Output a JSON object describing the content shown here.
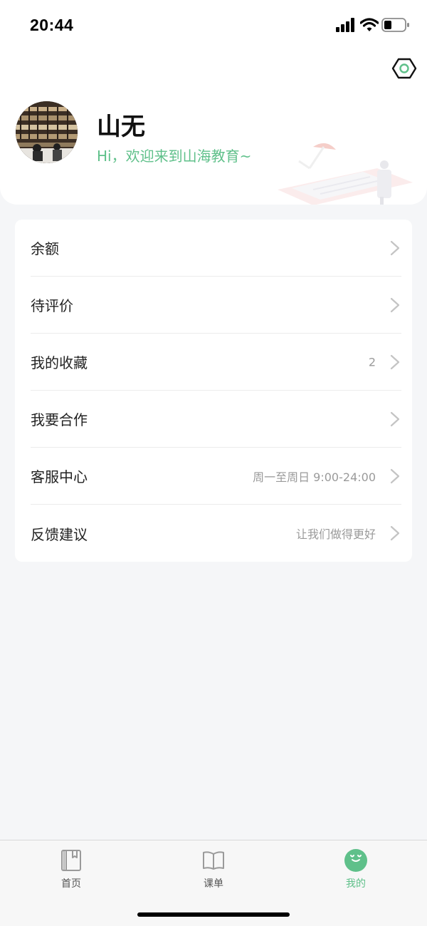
{
  "status_bar": {
    "time": "20:44"
  },
  "profile": {
    "name": "山无",
    "greeting": "Hi，欢迎来到山海教育~"
  },
  "menu": [
    {
      "label": "余额",
      "extra": ""
    },
    {
      "label": "待评价",
      "extra": ""
    },
    {
      "label": "我的收藏",
      "extra": "2"
    },
    {
      "label": "我要合作",
      "extra": ""
    },
    {
      "label": "客服中心",
      "extra": "周一至周日 9:00-24:00"
    },
    {
      "label": "反馈建议",
      "extra": "让我们做得更好"
    }
  ],
  "tabs": [
    {
      "label": "首页",
      "icon": "notebook-icon"
    },
    {
      "label": "课单",
      "icon": "open-book-icon"
    },
    {
      "label": "我的",
      "icon": "smiley-face-icon"
    }
  ],
  "colors": {
    "accent": "#5fc08a",
    "background": "#f5f6f8",
    "card": "#ffffff"
  }
}
